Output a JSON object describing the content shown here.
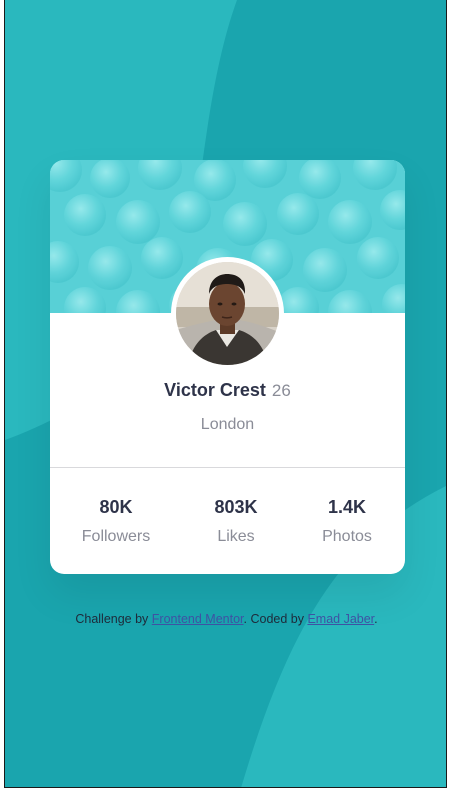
{
  "colors": {
    "background": "#1aa5ae",
    "background_shape_light": "#2bbcc1",
    "header": "#5fd4da",
    "dark_text": "#2e3349",
    "muted_text": "#8a8c97",
    "link": "#3e52a3"
  },
  "profile": {
    "name": "Victor Crest",
    "age": "26",
    "location": "London",
    "avatar_icon": "profile-photo"
  },
  "stats": [
    {
      "value": "80K",
      "label": "Followers"
    },
    {
      "value": "803K",
      "label": "Likes"
    },
    {
      "value": "1.4K",
      "label": "Photos"
    }
  ],
  "attribution": {
    "prefix": "Challenge by ",
    "link1": "Frontend Mentor",
    "middle": ". Coded by ",
    "link2": "Emad Jaber",
    "suffix": "."
  }
}
